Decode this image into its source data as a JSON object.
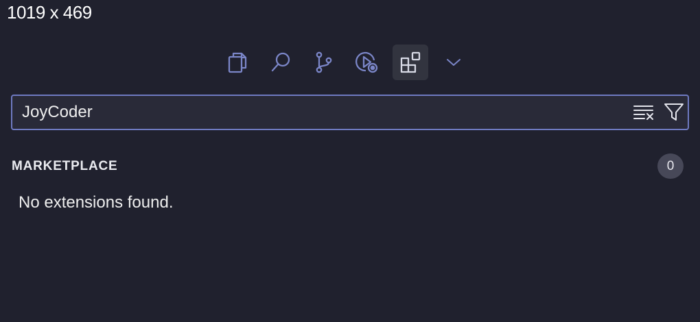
{
  "overlay": {
    "dimensions_label": "1019 x 469"
  },
  "activity_bar": {
    "items": [
      {
        "icon": "files-icon",
        "active": false
      },
      {
        "icon": "search-icon",
        "active": false
      },
      {
        "icon": "source-control-icon",
        "active": false
      },
      {
        "icon": "run-debug-icon",
        "active": false
      },
      {
        "icon": "extensions-icon",
        "active": true
      },
      {
        "icon": "chevron-down-icon",
        "active": false
      }
    ]
  },
  "search": {
    "value": "JoyCoder",
    "actions": [
      {
        "icon": "clear-results-icon"
      },
      {
        "icon": "filter-icon"
      }
    ]
  },
  "marketplace": {
    "title": "MARKETPLACE",
    "count": "0",
    "empty_message": "No extensions found."
  },
  "colors": {
    "background": "#20212e",
    "input_background": "#292a38",
    "focus_border": "#6f7bc2",
    "icon": "#7b86c8",
    "active_tab_background": "#32343f",
    "badge_background": "#474858"
  }
}
